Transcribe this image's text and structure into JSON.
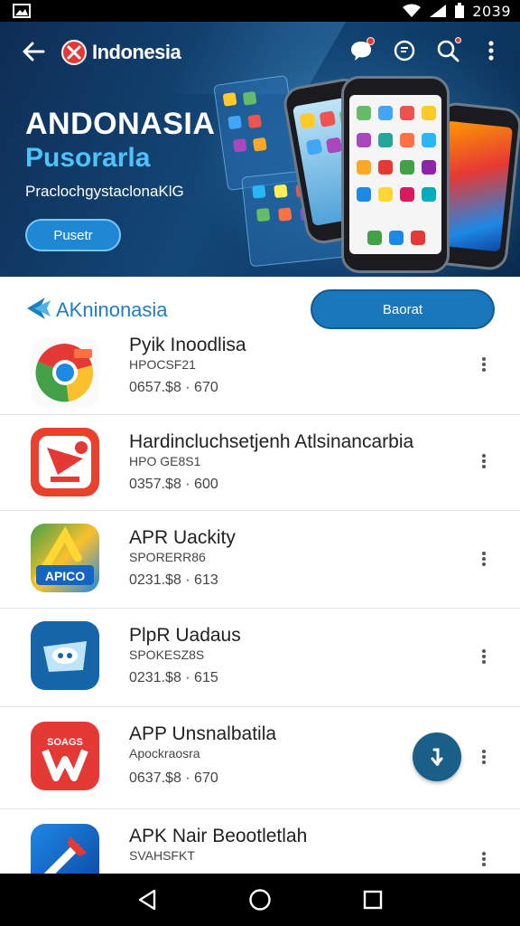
{
  "status_bar": {
    "time": "2039"
  },
  "app_bar": {
    "title": "Indonesia"
  },
  "hero": {
    "title": "ANDONASIA",
    "subtitle": "Pusorarla",
    "description": "PraclochgystaclonaKlG",
    "button_label": "Pusetr"
  },
  "section": {
    "title": "AKninonasia",
    "button_label": "Baorat"
  },
  "apps": [
    {
      "name": "Pyik Inoodlisa",
      "developer": "HPOCSF21",
      "meta": "0657.$8 · 670",
      "icon": "chrome-icon"
    },
    {
      "name": "Hardincluchsetjenh Atlsinancarbia",
      "developer": "HPO GE8S1",
      "meta": "0357.$8 · 600",
      "icon": "red-arrow-app-icon"
    },
    {
      "name": "APR Uackity",
      "developer": "SPORERR86",
      "meta": "0231.$8 · 613",
      "icon": "apico-icon"
    },
    {
      "name": "PlpR Uadaus",
      "developer": "SPOKESZ8S",
      "meta": "0231.$8 · 615",
      "icon": "cloud-chat-icon"
    },
    {
      "name": "APP Unsnalbatila",
      "developer": "Apockraosra",
      "meta": "0637.$8 · 670",
      "icon": "red-w-app-icon"
    },
    {
      "name": "APK Nair Beootletlah",
      "developer": "SVAHSFKT",
      "meta": "",
      "icon": "blue-tools-icon"
    }
  ],
  "colors": {
    "hero_bg": "#134777",
    "accent": "#1a77bb",
    "section_title": "#1e7fc0",
    "fab": "#1a5f88"
  }
}
